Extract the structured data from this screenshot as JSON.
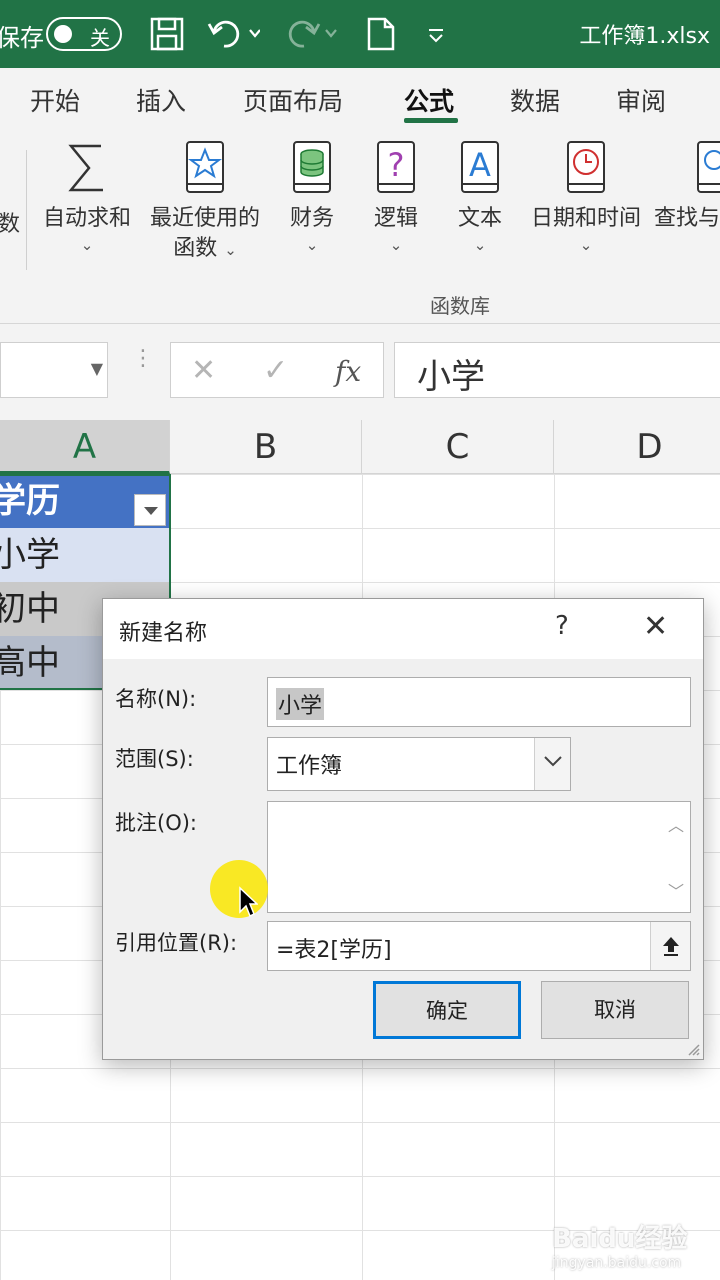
{
  "titlebar": {
    "autosave_label": "保存",
    "autosave_state": "关",
    "doc_title": "工作簿1.xlsx",
    "icons": [
      "save-icon",
      "undo-icon",
      "redo-icon",
      "new-file-icon",
      "customize-qat-icon"
    ]
  },
  "ribbon_tabs": [
    "开始",
    "插入",
    "页面布局",
    "公式",
    "数据",
    "审阅"
  ],
  "active_tab": "公式",
  "ribbon": {
    "partial_left_label": "数",
    "buttons": [
      {
        "label": "自动求和",
        "label2": "",
        "icon": "sigma-icon"
      },
      {
        "label": "最近使用的",
        "label2": "函数",
        "icon": "star-book-icon"
      },
      {
        "label": "财务",
        "label2": "",
        "icon": "coins-book-icon"
      },
      {
        "label": "逻辑",
        "label2": "",
        "icon": "question-book-icon"
      },
      {
        "label": "文本",
        "label2": "",
        "icon": "text-book-icon"
      },
      {
        "label": "日期和时间",
        "label2": "",
        "icon": "clock-book-icon"
      },
      {
        "label": "查找与",
        "label2": "",
        "icon": "search-book-icon"
      }
    ],
    "group_label": "函数库"
  },
  "formula_bar": {
    "cancel_symbol": "✕",
    "enter_symbol": "✓",
    "fx_label": "fx",
    "content": "小学"
  },
  "columns": [
    "A",
    "B",
    "C",
    "D"
  ],
  "table": {
    "header": "学历",
    "rows": [
      "小学",
      "初中",
      "高中"
    ]
  },
  "dialog": {
    "title": "新建名称",
    "help": "?",
    "close": "✕",
    "name_label": "名称(N):",
    "name_value": "小学",
    "scope_label": "范围(S):",
    "scope_value": "工作簿",
    "comment_label": "批注(O):",
    "comment_value": "",
    "refers_label": "引用位置(R):",
    "refers_value": "=表2[学历]",
    "ok_label": "确定",
    "cancel_label": "取消"
  },
  "watermark": {
    "brand": "Baidu经验",
    "site": "jingyan.baidu.com"
  },
  "colors": {
    "excel_green": "#217346",
    "table_header_blue": "#4472c4",
    "dialog_focus": "#0078d7"
  }
}
